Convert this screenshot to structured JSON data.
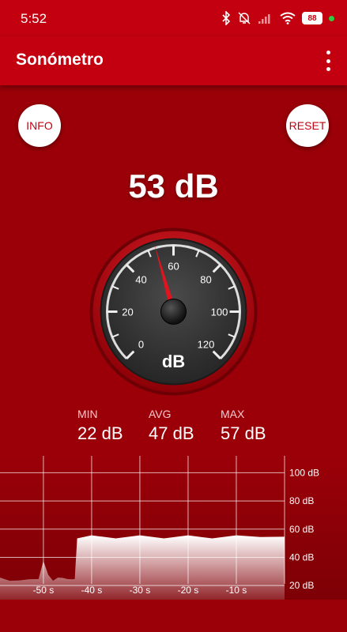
{
  "status_bar": {
    "time": "5:52",
    "battery": "88",
    "icons": [
      "bluetooth-icon",
      "mute-icon",
      "signal-icon",
      "wifi-icon",
      "battery-icon",
      "notification-dot-icon"
    ]
  },
  "app_bar": {
    "title": "Sonómetro",
    "menu_icon": "more-vert-icon"
  },
  "buttons": {
    "info": "INFO",
    "reset": "RESET"
  },
  "reading": {
    "value_text": "53 dB",
    "value": 53
  },
  "gauge": {
    "unit": "dB",
    "min": 0,
    "max": 120,
    "tick_labels": [
      "0",
      "20",
      "40",
      "60",
      "80",
      "100",
      "120"
    ],
    "needle_value": 53
  },
  "stats": {
    "min_label": "MIN",
    "min_value": "22 dB",
    "avg_label": "AVG",
    "avg_value": "47 dB",
    "max_label": "MAX",
    "max_value": "57 dB"
  },
  "chart_data": {
    "type": "area",
    "x_ticks": [
      "-50 s",
      "-40 s",
      "-30 s",
      "-20 s",
      "-10 s"
    ],
    "x_tick_values": [
      -50,
      -40,
      -30,
      -20,
      -10
    ],
    "y_ticks": [
      "100 dB",
      "80 dB",
      "60 dB",
      "40 dB",
      "20 dB"
    ],
    "y_tick_values": [
      100,
      80,
      60,
      40,
      20
    ],
    "xlim": [
      -59,
      0
    ],
    "ylim": [
      10,
      112
    ],
    "grid": true,
    "series": [
      {
        "x": [
          -59,
          -57,
          -55,
          -53,
          -51,
          -50,
          -49,
          -48,
          -47,
          -46,
          -45,
          -44,
          -43.5,
          -43,
          -40,
          -35,
          -30,
          -25,
          -20,
          -15,
          -10,
          -5,
          0
        ],
        "y": [
          25,
          24,
          23,
          25,
          24,
          38,
          27,
          24,
          25,
          26,
          24,
          25,
          24,
          54,
          55,
          54,
          55,
          54,
          55,
          54,
          55,
          55,
          54
        ]
      }
    ]
  }
}
